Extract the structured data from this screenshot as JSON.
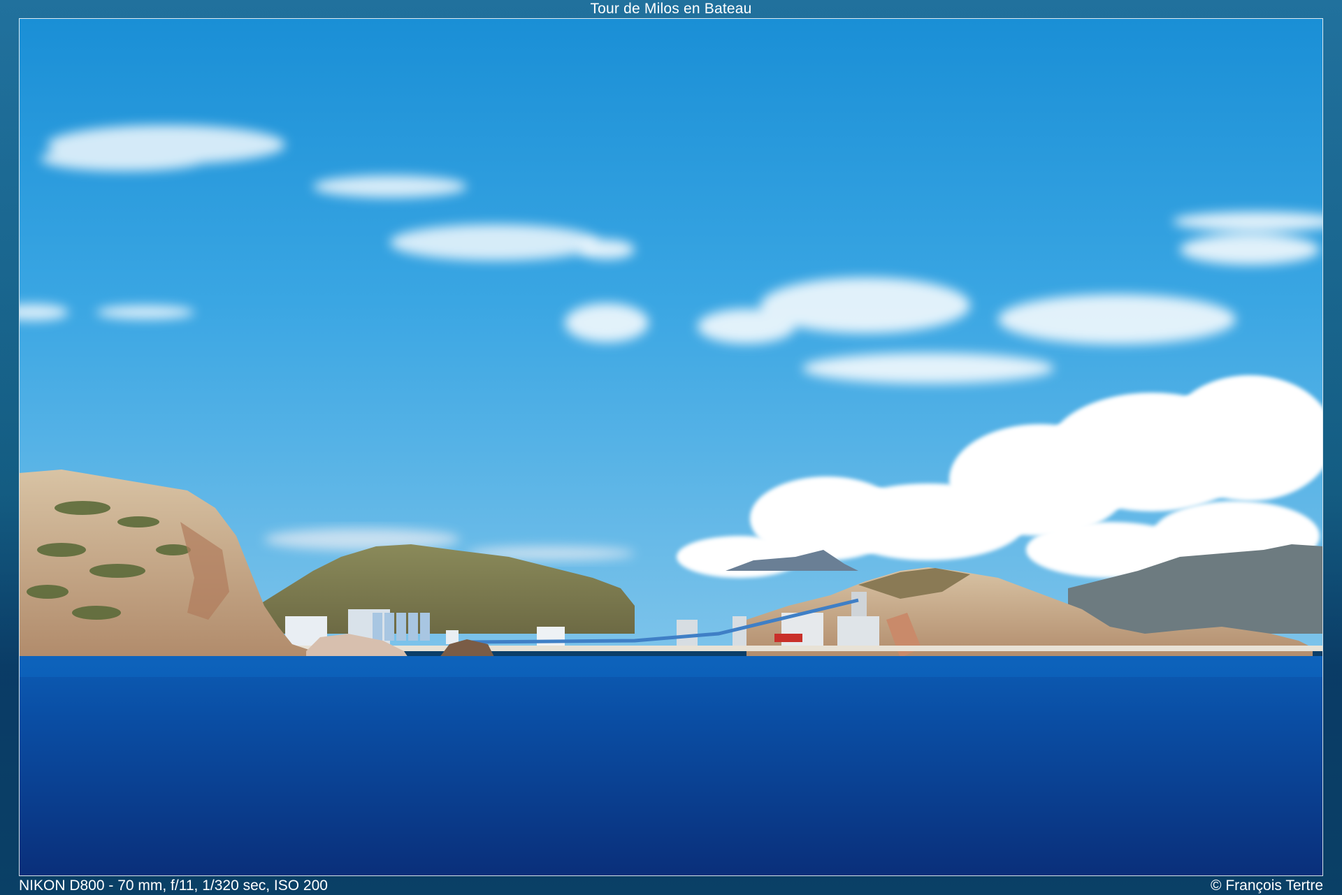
{
  "viewer": {
    "title": "Tour de Milos en Bateau",
    "exif": "NIKON D800 - 70 mm, f/11, 1/320 sec, ISO 200",
    "copyright": "© François Tertre"
  },
  "photo": {
    "scene": "coastline-with-industrial-plant",
    "colors": {
      "sky_top": "#1a8fd6",
      "sky_bottom": "#7cc3ea",
      "sea_top": "#0a4fa8",
      "sea_bottom": "#0a2f7a",
      "rock": "#c9ad8c",
      "vegetation": "#5c6b3a",
      "cloud": "#ffffff",
      "frame_border": "#ffffff"
    }
  }
}
